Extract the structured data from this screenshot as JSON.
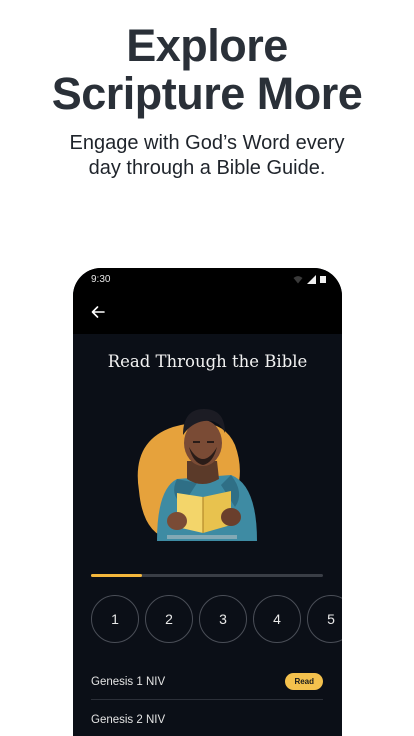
{
  "promo": {
    "headline_line1": "Explore",
    "headline_line2": "Scripture More",
    "subline_line1": "Engage with God’s Word every",
    "subline_line2": "day through a Bible Guide."
  },
  "phone": {
    "status_time": "9:30",
    "plan_title": "Read Through the Bible",
    "progress_fraction": 0.22,
    "days": [
      "1",
      "2",
      "3",
      "4",
      "5"
    ],
    "readings": [
      {
        "label": "Genesis 1 NIV",
        "badge": "Read"
      },
      {
        "label": "Genesis 2 NIV",
        "badge": ""
      }
    ],
    "icons": [
      "wifi-icon",
      "signal-icon",
      "battery-icon",
      "back-arrow-icon"
    ],
    "colors": {
      "accent": "#f4b73c",
      "screen_bg": "#0b0f17"
    }
  }
}
